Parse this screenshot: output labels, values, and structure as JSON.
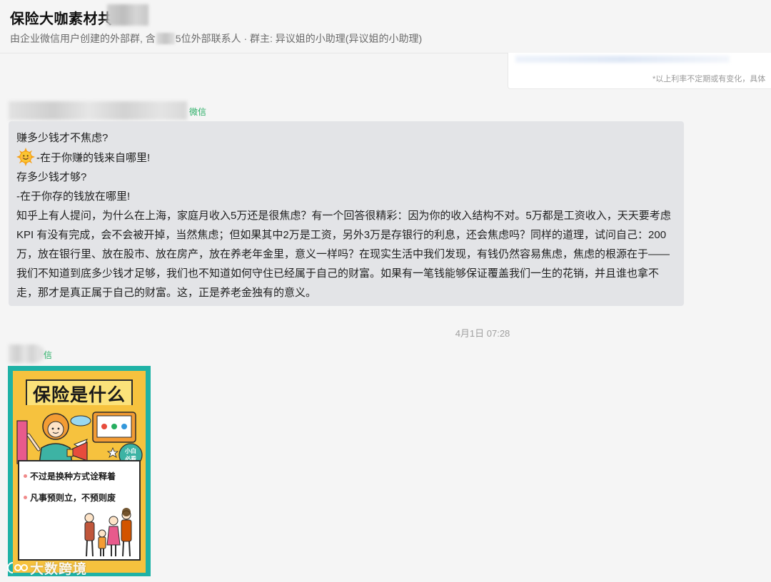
{
  "header": {
    "title": "保险大咖素材共",
    "subtitle_part1": "由企业微信用户创建的外部群, 含",
    "subtitle_part2": "5位外部联系人 · 群主: 异议姐的小助理(异议姐的小助理)"
  },
  "top_card": {
    "note": "*以上利率不定期或有变化，具体"
  },
  "messages": [
    {
      "sender_tag": "微信",
      "lines": [
        "赚多少钱才不焦虑?",
        "-在于你赚的钱来自哪里!",
        "存多少钱才够?",
        "-在于你存的钱放在哪里!",
        "知乎上有人提问，为什么在上海，家庭月收入5万还是很焦虑？有一个回答很精彩：因为你的收入结构不对。5万都是工资收入，天天要考虑 KPI 有没有完成，会不会被开掉，当然焦虑；但如果其中2万是工资，另外3万是存银行的利息，还会焦虑吗？同样的道理，试问自己：200万，放在银行里、放在股市、放在房产，放在养老年金里，意义一样吗？在现实生活中我们发现，有钱仍然容易焦虑，焦虑的根源在于——我们不知道到底多少钱才足够，我们也不知道如何守住已经属于自己的财富。如果有一笔钱能够保证覆盖我们一生的花销，并且谁也拿不走，那才是真正属于自己的财富。这，正是养老金独有的意义。"
      ],
      "emoji": "sun-emoji"
    }
  ],
  "timestamp": "4月1日 07:28",
  "image_message": {
    "sender_tag": "信",
    "poster_title": "保险是什么",
    "badge_text_1": "小白",
    "badge_text_2": "必看",
    "bullets": [
      "不过是换种方式诠释着",
      "凡事预则立，不预则废"
    ],
    "watermark": "大数跨境"
  },
  "colors": {
    "background": "#f5f5f5",
    "bubble": "#e3e4e7",
    "sender_tag": "#2bae67",
    "poster_border": "#1fb2a6",
    "poster_fill": "#f6c23e"
  }
}
